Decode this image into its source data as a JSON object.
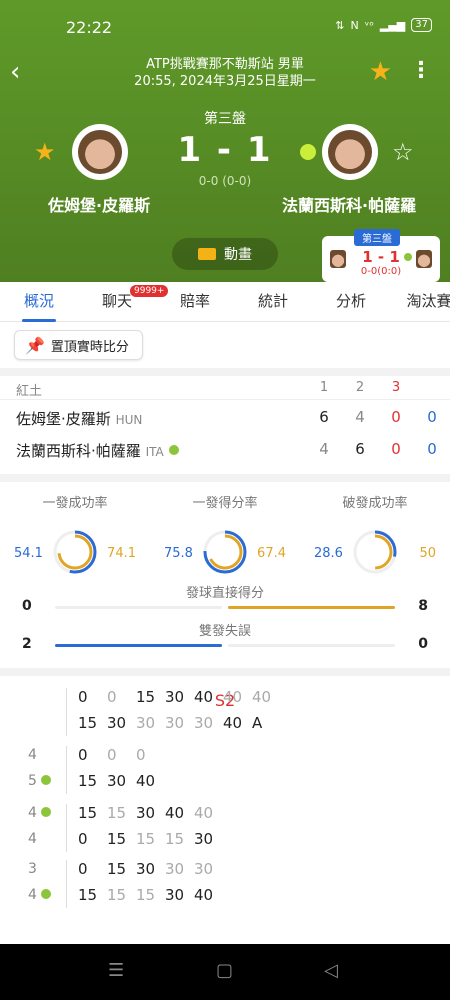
{
  "status": {
    "time": "22:22",
    "icons": [
      "network-speed",
      "nfc",
      "volte",
      "4g",
      "signal"
    ],
    "battery": "37"
  },
  "header": {
    "title": "ATP挑戰賽那不勒斯站 男單",
    "datetime": "20:55, 2024年3月25日星期一",
    "set_label": "第三盤",
    "score": "1 - 1",
    "game_score": "0-0 (0-0)",
    "player1": {
      "name": "佐姆堡·皮羅斯",
      "favorite": true
    },
    "player2": {
      "name": "法蘭西斯科·帕薩羅",
      "favorite": false,
      "serving": true
    },
    "animation_label": "動畫"
  },
  "mini_card": {
    "tag": "第三盤",
    "score": "1 - 1",
    "sub": "0-0(0:0)"
  },
  "tabs": [
    {
      "label": "概況",
      "active": true
    },
    {
      "label": "聊天",
      "badge": "9999+"
    },
    {
      "label": "賠率"
    },
    {
      "label": "統計"
    },
    {
      "label": "分析"
    },
    {
      "label": "淘汰賽"
    }
  ],
  "pin_label": "置頂實時比分",
  "scoreboard": {
    "surface": "紅土",
    "sets": [
      "1",
      "2",
      "3"
    ],
    "rows": [
      {
        "name": "佐姆堡·皮羅斯",
        "nation": "HUN",
        "sets": [
          "6",
          "4",
          "0"
        ],
        "points": "0"
      },
      {
        "name": "法蘭西斯科·帕薩羅",
        "nation": "ITA",
        "sets": [
          "4",
          "6",
          "0"
        ],
        "points": "0"
      }
    ]
  },
  "stats": {
    "rings": [
      {
        "title": "一發成功率",
        "left": "54.1",
        "right": "74.1"
      },
      {
        "title": "一發得分率",
        "left": "75.8",
        "right": "67.4"
      },
      {
        "title": "破發成功率",
        "left": "28.6",
        "right": "50"
      }
    ],
    "bars": [
      {
        "title": "發球直接得分",
        "left": "0",
        "right": "8"
      },
      {
        "title": "雙發失誤",
        "left": "2",
        "right": "0"
      }
    ]
  },
  "pbp": {
    "title": "S2",
    "blocks": [
      {
        "games": [
          "",
          ""
        ],
        "checks": [
          false,
          false
        ],
        "lines": [
          [
            "0",
            "0",
            "15",
            "30",
            "40",
            "40",
            "40"
          ],
          [
            "15",
            "30",
            "30",
            "30",
            "30",
            "40",
            "A"
          ]
        ]
      },
      {
        "games": [
          "4",
          "5"
        ],
        "checks": [
          false,
          true
        ],
        "lines": [
          [
            "0",
            "0",
            "0"
          ],
          [
            "15",
            "30",
            "40"
          ]
        ]
      },
      {
        "games": [
          "4",
          "4"
        ],
        "checks": [
          true,
          false
        ],
        "lines": [
          [
            "15",
            "15",
            "30",
            "40",
            "40"
          ],
          [
            "0",
            "15",
            "15",
            "15",
            "30"
          ]
        ]
      },
      {
        "games": [
          "3",
          "4"
        ],
        "checks": [
          false,
          true
        ],
        "lines": [
          [
            "0",
            "15",
            "30",
            "30",
            "30"
          ],
          [
            "15",
            "15",
            "15",
            "30",
            "40"
          ]
        ]
      }
    ]
  },
  "colors": {
    "header_bg": "#5a8f25",
    "accent_blue": "#2a6bd6",
    "accent_gold": "#e0a526",
    "accent_red": "#e03030"
  }
}
